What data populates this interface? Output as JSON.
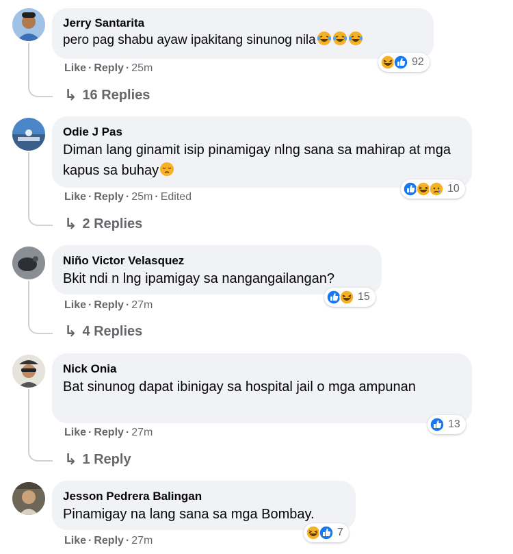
{
  "comments": [
    {
      "author": "Jerry Santarita",
      "text": "pero pag shabu ayaw ipakitang sinunog nila",
      "text_emojis": [
        "laugh-cry",
        "laugh-cry",
        "laugh-cry"
      ],
      "like": "Like",
      "reply": "Reply",
      "time": "25m",
      "edited": "",
      "reaction_icons": [
        "haha",
        "like"
      ],
      "reaction_count": "92",
      "replies_label": "16 Replies"
    },
    {
      "author": "Odie J Pas",
      "text": "Diman lang ginamit isip pinamigay nlng sana sa mahirap at mga kapus sa buhay",
      "text_emojis": [
        "pensive"
      ],
      "like": "Like",
      "reply": "Reply",
      "time": "25m",
      "edited": "Edited",
      "reaction_icons": [
        "like",
        "haha",
        "sad"
      ],
      "reaction_count": "10",
      "replies_label": "2 Replies"
    },
    {
      "author": "Niño Victor Velasquez",
      "text": "Bkit ndi n lng ipamigay sa nangangailangan?",
      "text_emojis": [],
      "like": "Like",
      "reply": "Reply",
      "time": "27m",
      "edited": "",
      "reaction_icons": [
        "like",
        "haha"
      ],
      "reaction_count": "15",
      "replies_label": "4 Replies"
    },
    {
      "author": "Nick Onia",
      "text": "Bat sinunog dapat ibinigay sa hospital jail o mga ampunan",
      "text_emojis": [],
      "like": "Like",
      "reply": "Reply",
      "time": "27m",
      "edited": "",
      "reaction_icons": [
        "like"
      ],
      "reaction_count": "13",
      "replies_label": "1 Reply"
    },
    {
      "author": "Jesson Pedrera Balingan",
      "text": "Pinamigay na lang sana sa mga Bombay.",
      "text_emojis": [],
      "like": "Like",
      "reply": "Reply",
      "time": "27m",
      "edited": "",
      "reaction_icons": [
        "haha",
        "like"
      ],
      "reaction_count": "7",
      "replies_label": ""
    }
  ],
  "separator": "·",
  "reply_arrow": "↳",
  "colors": {
    "like": "#1877f2",
    "haha": "#f7b125",
    "bubble": "#f0f2f5",
    "muted": "#65676b"
  }
}
